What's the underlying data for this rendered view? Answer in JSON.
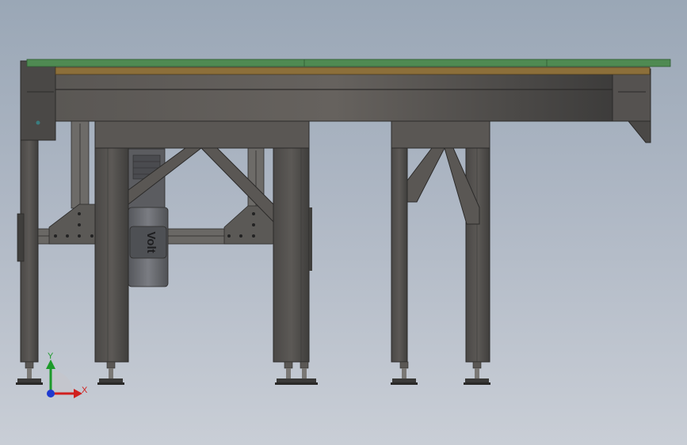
{
  "viewport": {
    "background_top": "#9aa7b6",
    "background_bottom": "#c9ced6"
  },
  "model": {
    "motor_brand": "Volt",
    "frame_color": "#4d4b49",
    "belt_color": "#4f8a52",
    "board_color": "#8c6f3a",
    "motor_color": "#6a6c72"
  },
  "triad": {
    "x_label": "X",
    "y_label": "Y",
    "x_color": "#d0201e",
    "y_color": "#1c9a2a",
    "z_color": "#1e3ad0"
  }
}
